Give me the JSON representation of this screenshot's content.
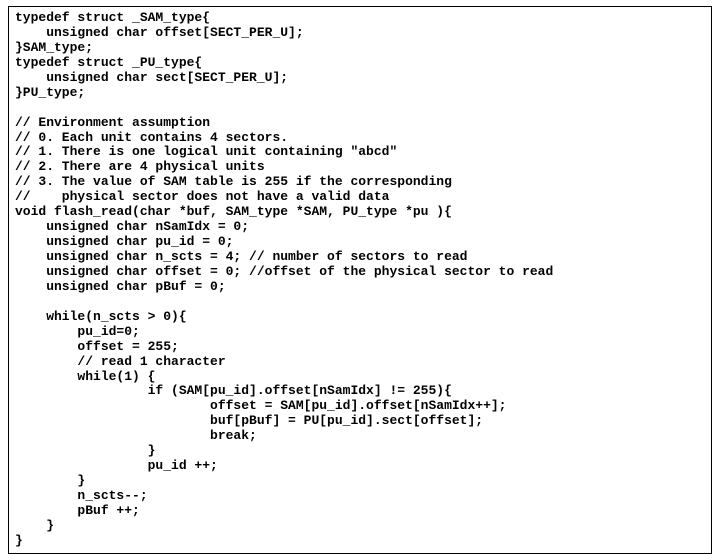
{
  "code": {
    "l01": "typedef struct _SAM_type{",
    "l02": "    unsigned char offset[SECT_PER_U];",
    "l03": "}SAM_type;",
    "l04": "typedef struct _PU_type{",
    "l05": "    unsigned char sect[SECT_PER_U];",
    "l06": "}PU_type;",
    "l07": "",
    "l08": "// Environment assumption",
    "l09": "// 0. Each unit contains 4 sectors.",
    "l10": "// 1. There is one logical unit containing \"abcd\"",
    "l11": "// 2. There are 4 physical units",
    "l12": "// 3. The value of SAM table is 255 if the corresponding",
    "l13": "//    physical sector does not have a valid data",
    "l14": "void flash_read(char *buf, SAM_type *SAM, PU_type *pu ){",
    "l15": "    unsigned char nSamIdx = 0;",
    "l16": "    unsigned char pu_id = 0;",
    "l17": "    unsigned char n_scts = 4; // number of sectors to read",
    "l18": "    unsigned char offset = 0; //offset of the physical sector to read",
    "l19": "    unsigned char pBuf = 0;",
    "l20": "",
    "l21": "    while(n_scts > 0){",
    "l22": "        pu_id=0;",
    "l23": "        offset = 255;",
    "l24": "        // read 1 character",
    "l25": "        while(1) {",
    "l26": "                 if (SAM[pu_id].offset[nSamIdx] != 255){",
    "l27": "                         offset = SAM[pu_id].offset[nSamIdx++];",
    "l28": "                         buf[pBuf] = PU[pu_id].sect[offset];",
    "l29": "                         break;",
    "l30": "                 }",
    "l31": "                 pu_id ++;",
    "l32": "        }",
    "l33": "        n_scts--;",
    "l34": "        pBuf ++;",
    "l35": "    }",
    "l36": "}"
  }
}
